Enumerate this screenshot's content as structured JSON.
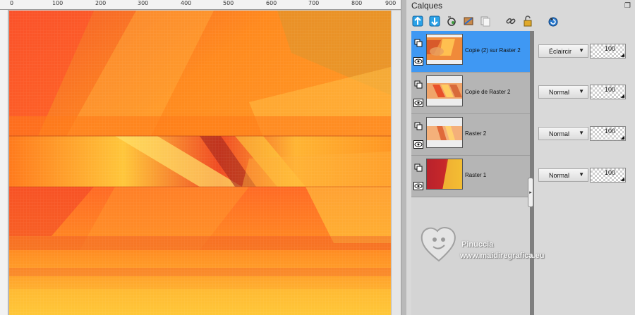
{
  "ruler": {
    "top_labels": [
      "0",
      "100",
      "200",
      "300",
      "400",
      "500",
      "600",
      "700",
      "800",
      "900"
    ]
  },
  "panel": {
    "title": "Calques",
    "toolbar_icons": [
      "new-raster-layer-icon",
      "new-vector-layer-icon",
      "new-mask-layer-icon",
      "layer-properties-icon",
      "duplicate-layer-icon",
      "link-icon",
      "lock-icon",
      "refresh-icon"
    ]
  },
  "layers": [
    {
      "name": "Copie (2) sur Raster 2",
      "blend_mode": "Éclaircir",
      "opacity": "100",
      "selected": true
    },
    {
      "name": "Copie de Raster 2",
      "blend_mode": "Normal",
      "opacity": "100",
      "selected": false
    },
    {
      "name": "Raster 2",
      "blend_mode": "Normal",
      "opacity": "100",
      "selected": false
    },
    {
      "name": "Raster 1",
      "blend_mode": "Normal",
      "opacity": "100",
      "selected": false
    }
  ],
  "watermark": {
    "name": "Pinuccia",
    "url": "www.maidiregrafica.eu"
  },
  "colors": {
    "selection": "#3f98f3",
    "orange": "#ff8a1e",
    "red": "#e8322a",
    "yellow": "#ffd23c"
  }
}
